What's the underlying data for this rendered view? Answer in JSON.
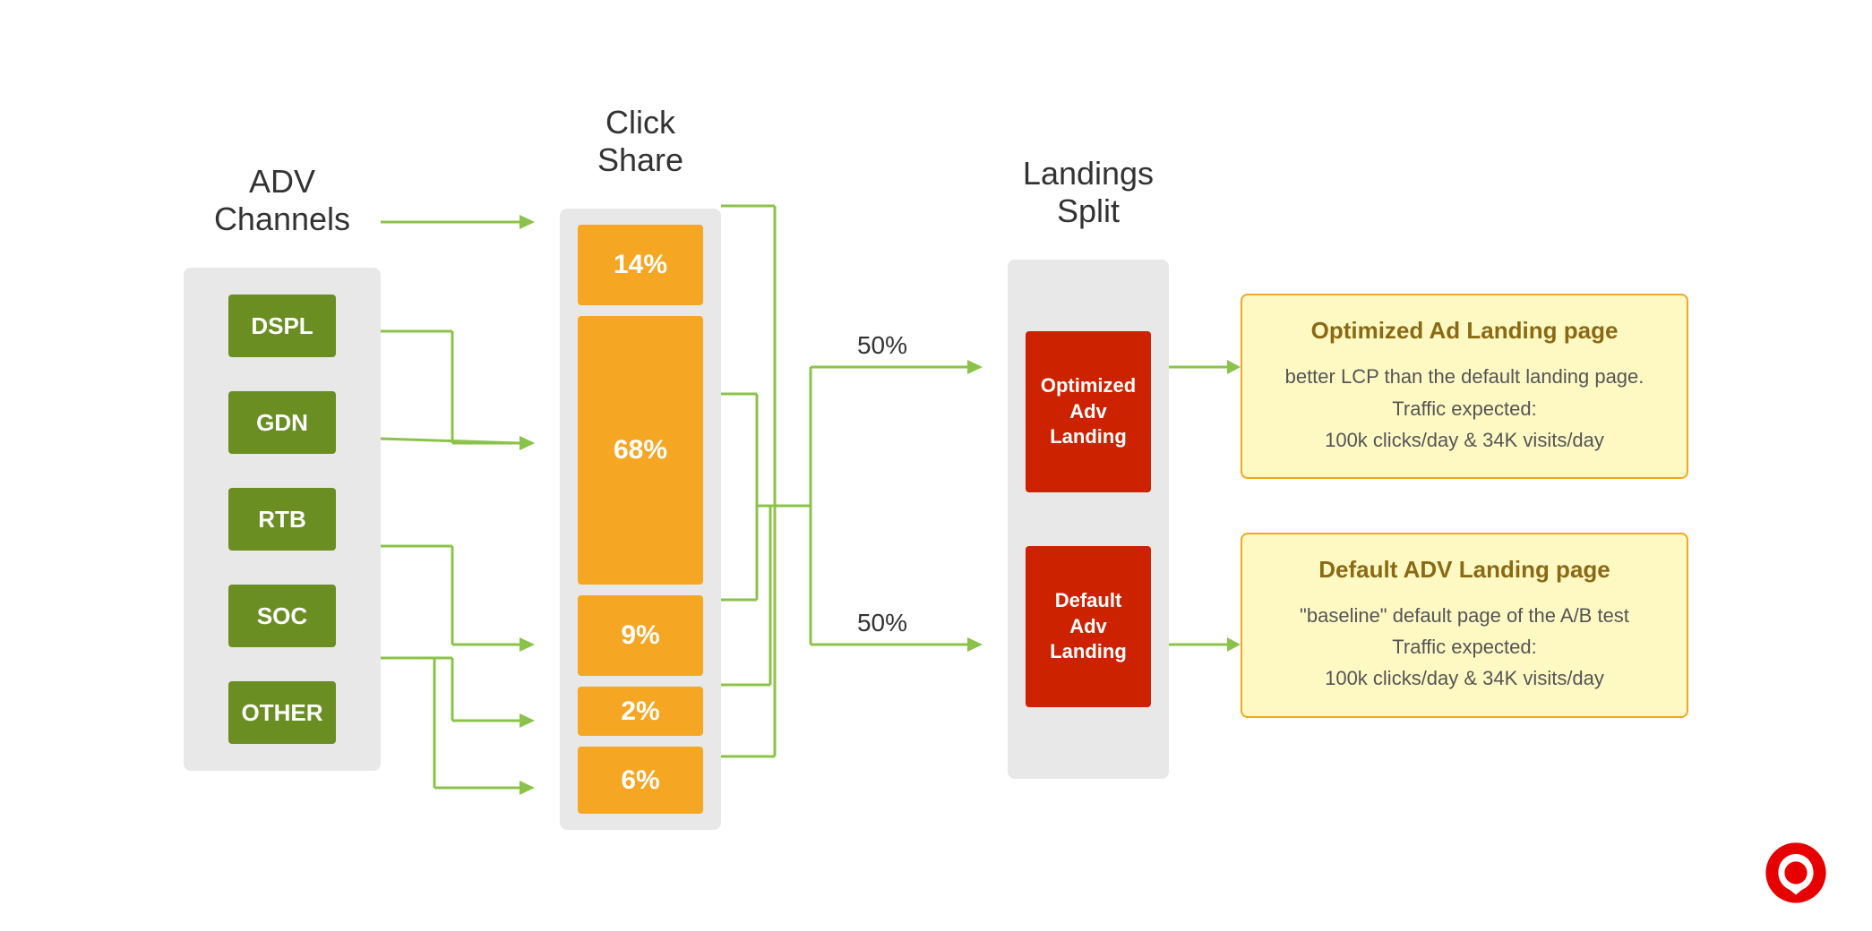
{
  "headers": {
    "adv": "ADV\nChannels",
    "clickShare": "Click\nShare",
    "landingsSplit": "Landings\nSplit"
  },
  "advChannels": [
    {
      "id": "dspl",
      "label": "DSPL"
    },
    {
      "id": "gdn",
      "label": "GDN"
    },
    {
      "id": "rtb",
      "label": "RTB"
    },
    {
      "id": "soc",
      "label": "SOC"
    },
    {
      "id": "other",
      "label": "OTHER"
    }
  ],
  "clickShares": [
    {
      "id": "cs14",
      "value": "14%",
      "sizeClass": "click-box-14"
    },
    {
      "id": "cs68",
      "value": "68%",
      "sizeClass": "click-box-68"
    },
    {
      "id": "cs9",
      "value": "9%",
      "sizeClass": "click-box-9"
    },
    {
      "id": "cs2",
      "value": "2%",
      "sizeClass": "click-box-2"
    },
    {
      "id": "cs6",
      "value": "6%",
      "sizeClass": "click-box-6"
    }
  ],
  "landingSplitLabels": [
    {
      "id": "optimized",
      "line1": "Optimized",
      "line2": "Adv",
      "line3": "Landing"
    },
    {
      "id": "default",
      "line1": "Default",
      "line2": "Adv",
      "line3": "Landing"
    }
  ],
  "splitPercentages": {
    "top": "50%",
    "bottom": "50%"
  },
  "infoCards": [
    {
      "id": "optimized-card",
      "title": "Optimized Ad Landing page",
      "body": "better LCP than the default landing page.\nTraffic expected:\n100k clicks/day  &  34K visits/day"
    },
    {
      "id": "default-card",
      "title": "Default ADV Landing page",
      "body": "\"baseline\" default page of the A/B test\nTraffic expected:\n100k clicks/day  &  34K visits/day"
    }
  ]
}
